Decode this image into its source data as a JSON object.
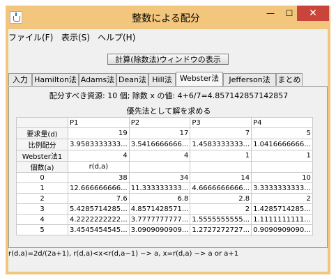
{
  "window": {
    "title": "整数による配分",
    "minimize": "—",
    "maximize": "☐",
    "close": "✕"
  },
  "menu": [
    "ファイル(F)",
    "表示(S)",
    "ヘルプ(H)"
  ],
  "calc_button": "計算(除数法)ウィンドウの表示",
  "tabs": [
    "入力",
    "Hamilton法",
    "Adams法",
    "Dean法",
    "Hill法",
    "Webster法",
    "Jefferson法",
    "まとめ"
  ],
  "active_tab": "Webster法",
  "info": "配分すべき資源: 10 個; 除数 x の値: 4+6/7=4.857142857142857",
  "preference": "優先法として解を求める",
  "table": {
    "columns": [
      "",
      "P1",
      "P2",
      "P3",
      "P4"
    ],
    "rows": [
      [
        "要求量(d)",
        "19",
        "17",
        "7",
        "5"
      ],
      [
        "比例配分",
        "3.9583333333...",
        "3.5416666666...",
        "1.4583333333...",
        "1.0416666666..."
      ],
      [
        "Webster法1",
        "4",
        "4",
        "1",
        "1"
      ],
      [
        "個数(a)",
        "r(d,a)",
        "",
        "",
        ""
      ],
      [
        "0",
        "38",
        "34",
        "14",
        "10"
      ],
      [
        "1",
        "12.666666666...",
        "11.333333333...",
        "4.6666666666...",
        "3.3333333333..."
      ],
      [
        "2",
        "7.6",
        "6.8",
        "2.8",
        "2"
      ],
      [
        "3",
        "5.4285714285...",
        "4.8571428571...",
        "2",
        "1.4285714285..."
      ],
      [
        "4",
        "4.2222222222...",
        "3.7777777777...",
        "1.5555555555...",
        "1.1111111111..."
      ],
      [
        "5",
        "3.4545454545...",
        "3.0909090909...",
        "1.2727272727...",
        "0.9090909090..."
      ]
    ]
  },
  "status": "r(d,a)=2d/(2a+1), r(d,a)<x<r(d,a−1) −> a, x=r(d,a) −> a or a+1"
}
